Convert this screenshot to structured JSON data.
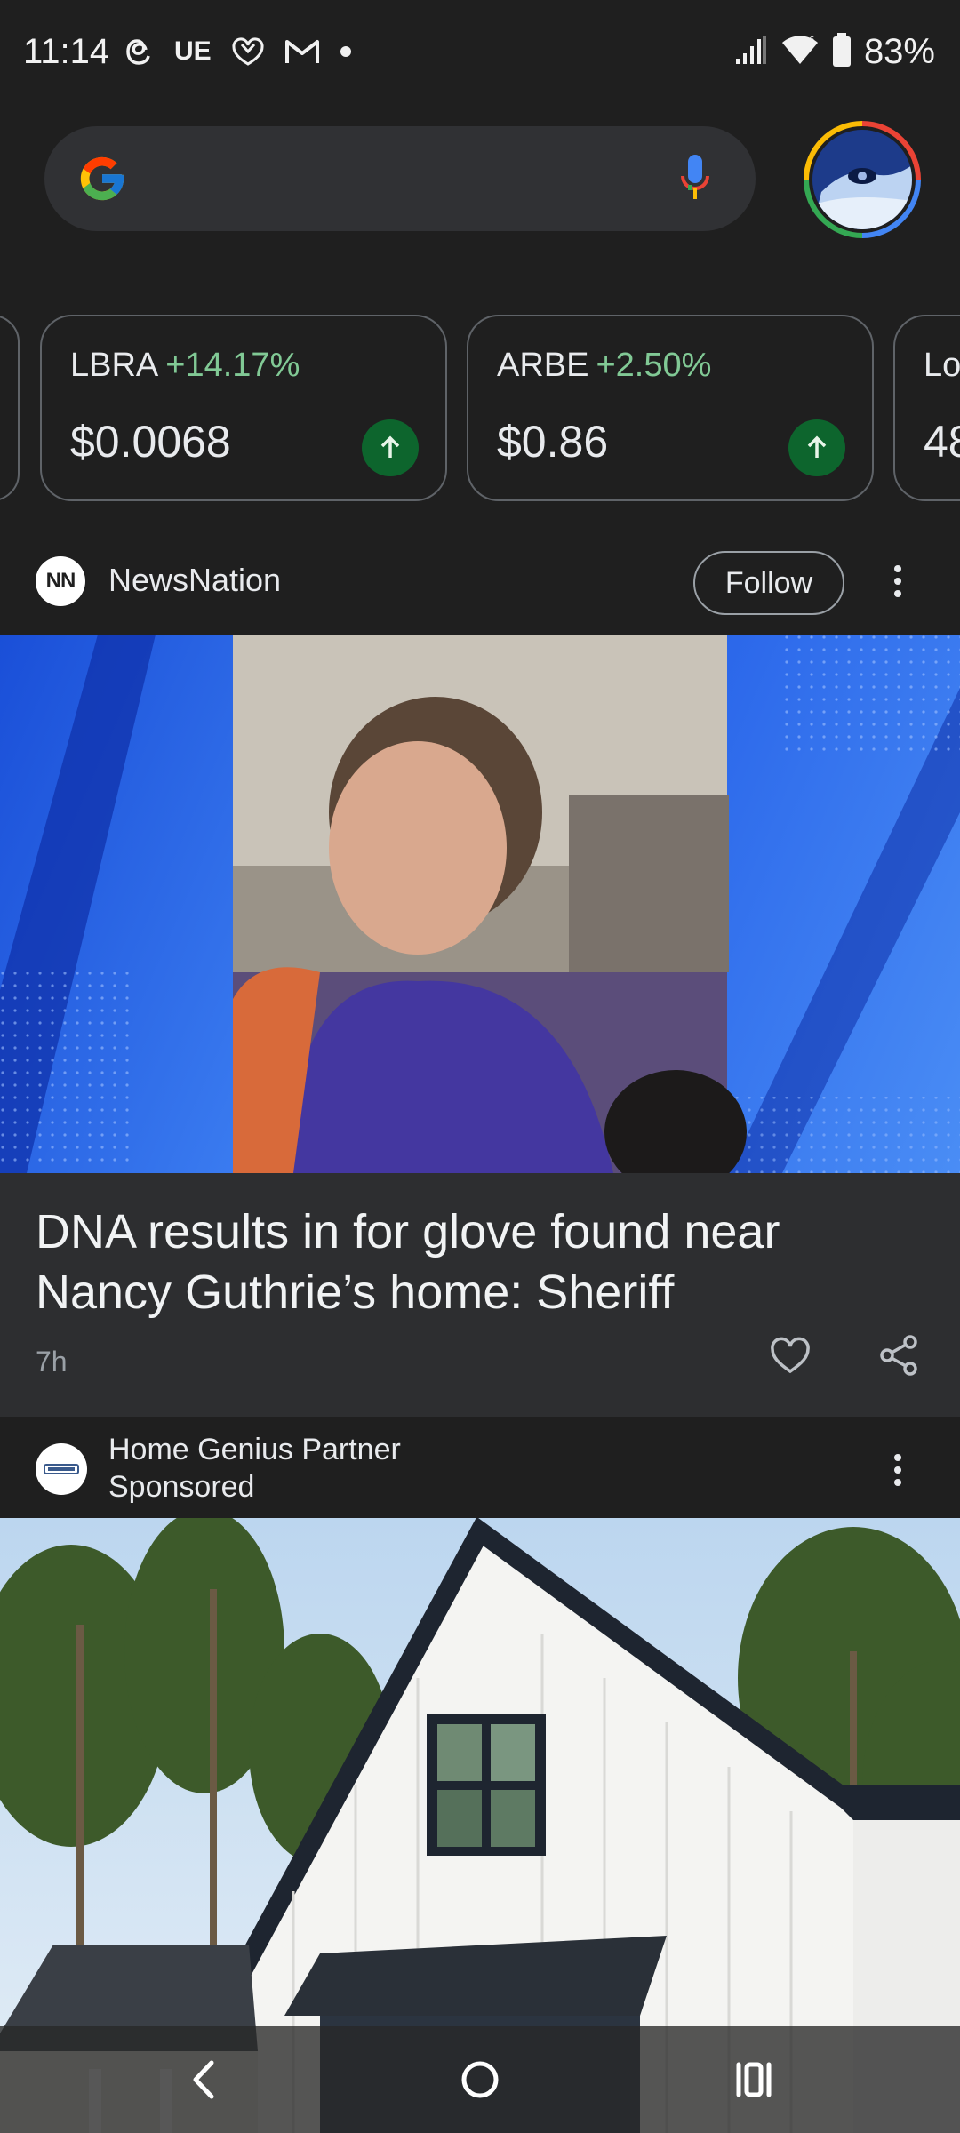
{
  "status_bar": {
    "time": "11:14",
    "left_icons": [
      "threads-icon",
      "ue-text",
      "wellness-icon",
      "gmail-icon",
      "dot"
    ],
    "ue_label": "UE",
    "battery": "83%"
  },
  "search": {
    "placeholder": ""
  },
  "stocks": [
    {
      "symbol": "LBRA",
      "change": "+14.17%",
      "price": "$0.0068"
    },
    {
      "symbol": "ARBE",
      "change": "+2.50%",
      "price": "$0.86"
    },
    {
      "symbol": "Lo",
      "change": "",
      "price": "48"
    }
  ],
  "news": {
    "source_logo_text": "NN",
    "source": "NewsNation",
    "follow_label": "Follow",
    "headline": "DNA results in for glove found near Nancy Guthrie’s home: Sheriff",
    "time": "7h"
  },
  "sponsored": {
    "name": "Home Genius Partner",
    "tag": "Sponsored"
  },
  "colors": {
    "background": "#1f1f1f",
    "card": "#2d2e30",
    "positive": "#81c995",
    "up_badge": "#0d652d",
    "news_blue": "#2a5bd6"
  }
}
